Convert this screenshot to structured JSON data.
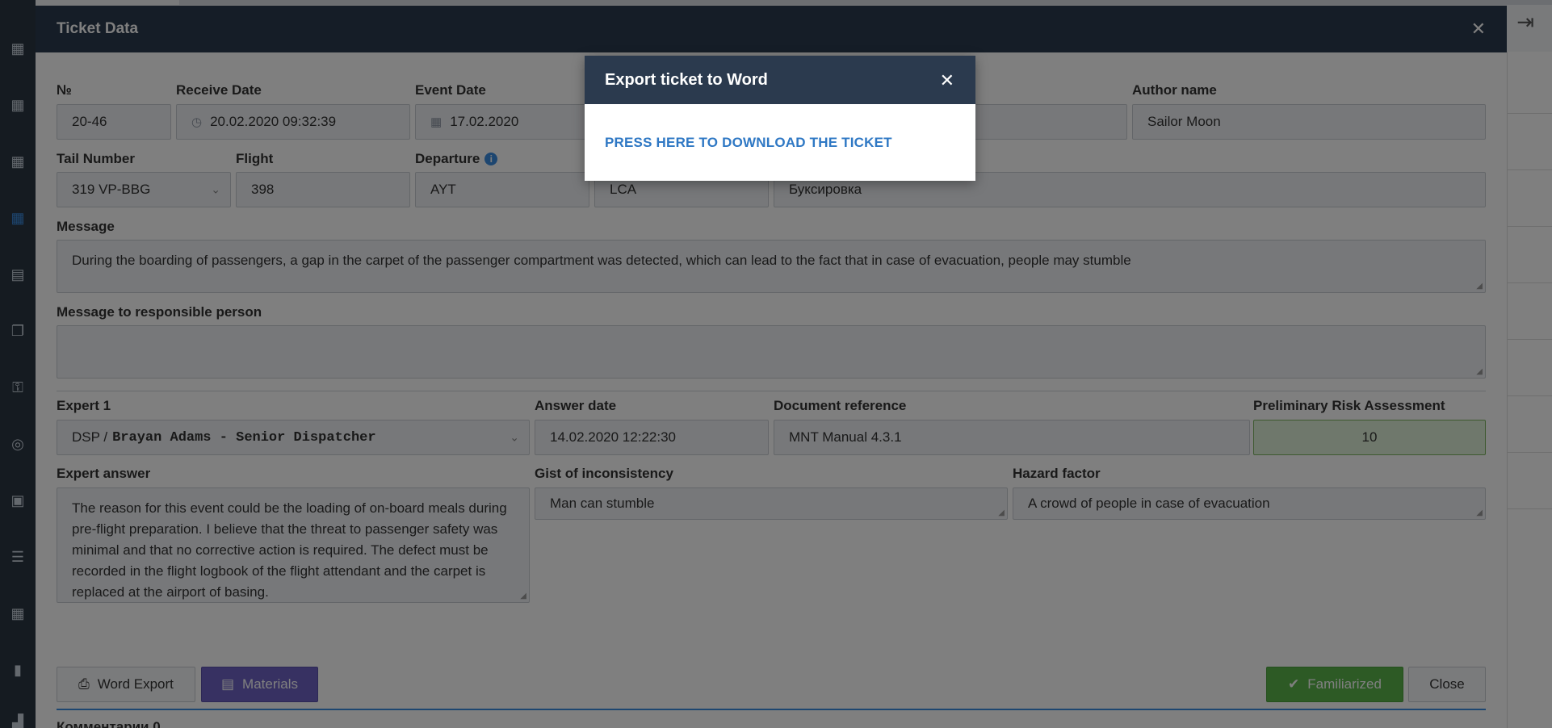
{
  "modal": {
    "title": "Ticket Data",
    "close_icon": "close-icon"
  },
  "row1": {
    "number": {
      "label": "№",
      "value": "20-46"
    },
    "receive_date": {
      "label": "Receive Date",
      "value": "20.02.2020 09:32:39"
    },
    "event_date": {
      "label": "Event Date",
      "value": "17.02.2020"
    },
    "author_name": {
      "label": "Author name",
      "value": "Sailor Moon"
    }
  },
  "row2": {
    "tail_number": {
      "label": "Tail Number",
      "value": "319 VP-BBG"
    },
    "flight": {
      "label": "Flight",
      "value": "398"
    },
    "departure": {
      "label": "Departure",
      "value": "AYT"
    },
    "arrival": {
      "value": "LCA"
    },
    "event": {
      "value": "Буксировка"
    }
  },
  "message": {
    "label": "Message",
    "value": "During the boarding of passengers, a gap in the carpet of the passenger compartment was detected, which can lead to the fact that in case of evacuation, people may stumble"
  },
  "message_responsible": {
    "label": "Message to responsible person",
    "value": ""
  },
  "expert": {
    "label": "Expert 1",
    "prefix": "DSP /",
    "name": "Brayan Adams - Senior Dispatcher"
  },
  "answer_date": {
    "label": "Answer date",
    "value": "14.02.2020 12:22:30"
  },
  "document_reference": {
    "label": "Document reference",
    "value": "MNT Manual 4.3.1"
  },
  "risk": {
    "label": "Preliminary Risk Assessment",
    "value": "10",
    "color": "#dff0d8"
  },
  "expert_answer": {
    "label": "Expert answer",
    "value": "The reason for this event could be the loading of on-board meals during pre-flight preparation. I believe that the threat to passenger safety was minimal and that no corrective action is required. The defect must be recorded in the flight logbook of the flight attendant and the carpet is replaced at the airport of basing."
  },
  "gist": {
    "label": "Gist of inconsistency",
    "value": "Man can stumble"
  },
  "hazard": {
    "label": "Hazard factor",
    "value": "A crowd of people in case of evacuation"
  },
  "buttons": {
    "word_export": "Word Export",
    "materials": "Materials",
    "familiarized": "Familiarized",
    "close": "Close"
  },
  "comments": {
    "label": "Комментарии 0"
  },
  "export_dialog": {
    "title": "Export ticket to Word",
    "link": "PRESS HERE TO DOWNLOAD THE TICKET"
  },
  "colors": {
    "header": "#2b3a4e",
    "accent": "#3b8ce0",
    "purple": "#6f63c4",
    "green": "#5ab54b"
  }
}
